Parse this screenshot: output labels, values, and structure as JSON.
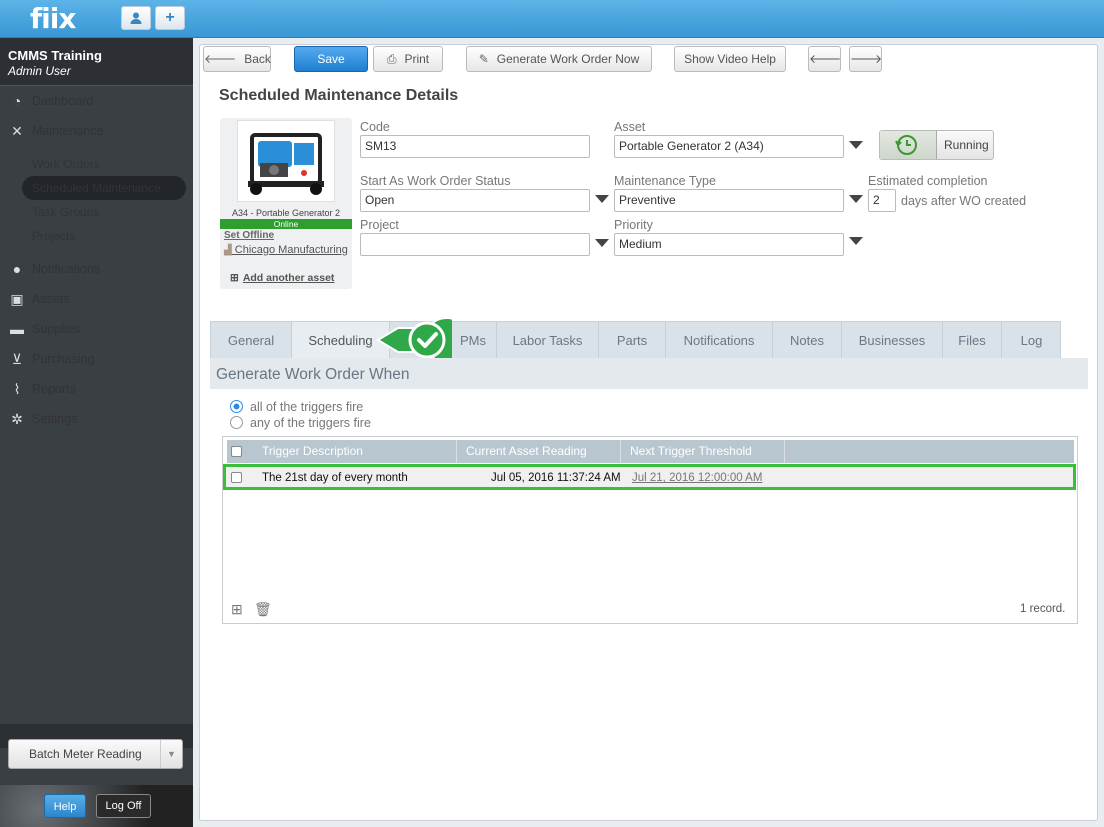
{
  "app": {
    "logo": "fiix",
    "topbar_icons": [
      "user-icon",
      "plus-icon"
    ],
    "plus_label": "+"
  },
  "org": {
    "name": "CMMS Training",
    "user": "Admin User"
  },
  "nav": {
    "dashboard": "Dashboard",
    "maintenance": "Maintenance",
    "maintenance_sub": [
      "Work Orders",
      "Scheduled Maintenance",
      "Task Groups",
      "Projects"
    ],
    "notifications": "Notifications",
    "assets": "Assets",
    "supplies": "Supplies",
    "purchasing": "Purchasing",
    "reports": "Reports",
    "settings": "Settings"
  },
  "sidebar_footer": {
    "batch": "Batch Meter Reading",
    "help": "Help",
    "logoff": "Log Off"
  },
  "toolbar": {
    "back": "Back",
    "save": "Save",
    "print": "Print",
    "generate": "Generate Work Order Now",
    "video": "Show Video Help"
  },
  "page_title": "Scheduled Maintenance Details",
  "asset_card": {
    "name": "A34 - Portable Generator 2",
    "status": "Online",
    "set_offline": "Set Offline",
    "location": "Chicago Manufacturing",
    "add_asset": "Add another asset"
  },
  "form": {
    "code_label": "Code",
    "code_value": "SM13",
    "asset_label": "Asset",
    "asset_value": "Portable Generator 2 (A34)",
    "running": "Running",
    "status_label": "Start As Work Order Status",
    "status_value": "Open",
    "type_label": "Maintenance Type",
    "type_value": "Preventive",
    "est_label": "Estimated completion",
    "est_value": "2",
    "est_suffix": "days after WO created",
    "project_label": "Project",
    "project_value": "",
    "priority_label": "Priority",
    "priority_value": "Medium"
  },
  "tabs": [
    "General",
    "Scheduling",
    "PMs",
    "Labor Tasks",
    "Parts",
    "Notifications",
    "Notes",
    "Businesses",
    "Files",
    "Log"
  ],
  "active_tab": "Scheduling",
  "scheduling": {
    "heading": "Generate Work Order When",
    "option_all": "all of the triggers fire",
    "option_any": "any of the triggers fire",
    "selected": "all",
    "columns": [
      "Trigger Description",
      "Current Asset Reading",
      "Next Trigger Threshold"
    ],
    "rows": [
      {
        "description": "The 21st day of every month",
        "reading": "Jul 05, 2016 11:37:24 AM",
        "threshold": "Jul 21, 2016 12:00:00 AM"
      }
    ],
    "record_count": "1 record."
  },
  "colors": {
    "accent": "#2d8ae0",
    "online": "#2e9e2e",
    "highlight": "#3bbf3b",
    "sidebar": "#3a3f44"
  }
}
